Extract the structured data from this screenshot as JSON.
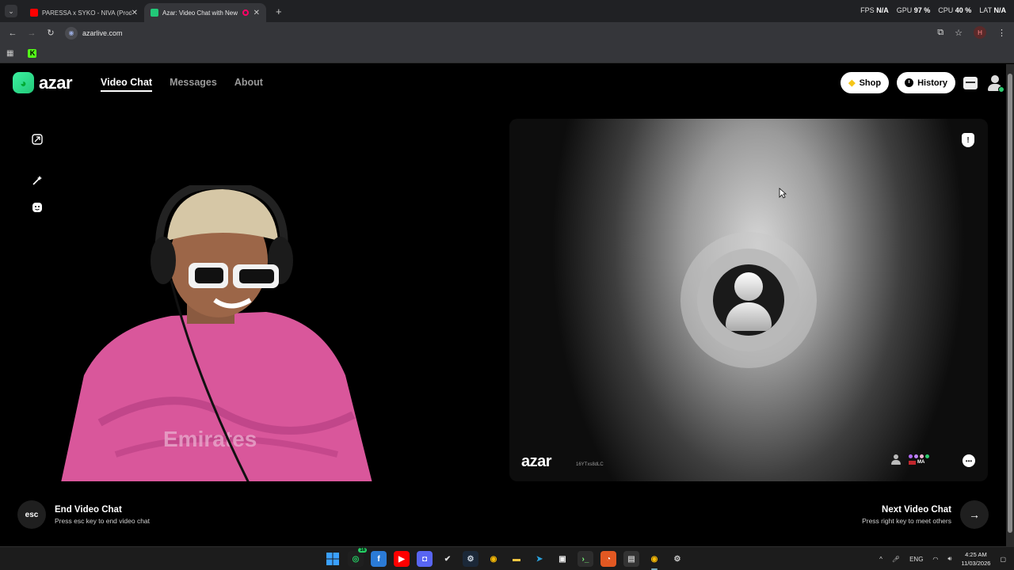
{
  "browser": {
    "tabs": [
      {
        "title": "PARESSA x SYKO - NIVA (Prod",
        "favicon_color": "#ff0000"
      },
      {
        "title": "Azar: Video Chat with New",
        "favicon_color": "#22c878"
      }
    ],
    "perf": {
      "fps_label": "FPS",
      "fps_value": "N/A",
      "gpu_label": "GPU",
      "gpu_value": "97 %",
      "cpu_label": "CPU",
      "cpu_value": "40 %",
      "lat_label": "LAT",
      "lat_value": "N/A"
    },
    "url": "azarlive.com",
    "profile_initial": "H"
  },
  "site": {
    "logo_text": "azar",
    "nav": [
      {
        "label": "Video Chat",
        "active": true
      },
      {
        "label": "Messages",
        "active": false
      },
      {
        "label": "About",
        "active": false
      }
    ],
    "shop_label": "Shop",
    "history_label": "History"
  },
  "remote": {
    "watermark": "azar",
    "user_id": "16YTxs8dLC",
    "country": "MA"
  },
  "controls": {
    "end": {
      "key": "esc",
      "title": "End Video Chat",
      "hint": "Press esc key to end video chat"
    },
    "next": {
      "title": "Next Video Chat",
      "hint": "Press right key to meet others"
    }
  },
  "taskbar": {
    "lang": "ENG",
    "time": "4:25 AM",
    "date": "11/03/2026",
    "whatsapp_badge": "16"
  },
  "colors": {
    "accent": "#22c878",
    "page_bg": "#000000",
    "chrome_bg": "#35363a"
  }
}
